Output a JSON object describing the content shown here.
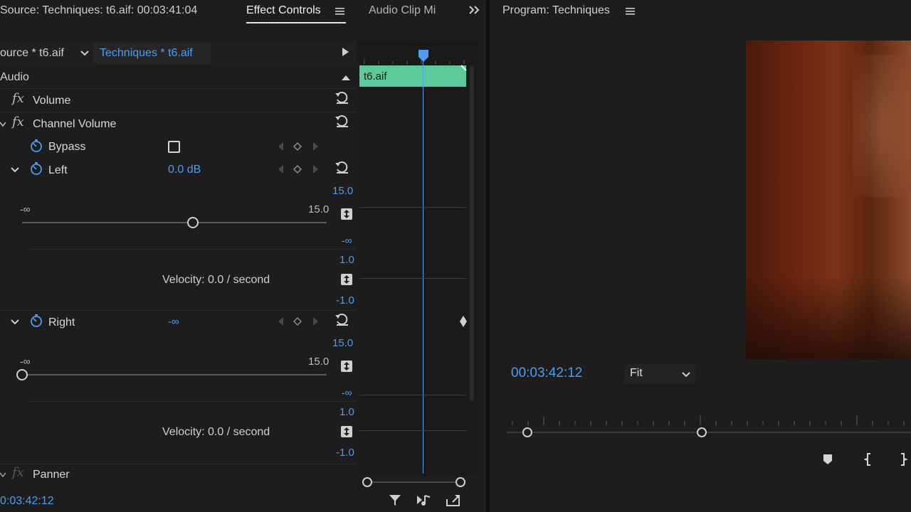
{
  "tabs": {
    "source": "Source: Techniques: t6.aif: 00:03:41:04",
    "effect_controls": "Effect Controls",
    "audio_clip_mixer": "Audio Clip Mi",
    "program": "Program: Techniques"
  },
  "breadcrumb": {
    "master": "ource * t6.aif",
    "sequence": "Techniques * t6.aif"
  },
  "section": {
    "title": "Audio"
  },
  "effects": {
    "volume": "Volume",
    "channel_volume": "Channel Volume",
    "panner": "Panner"
  },
  "bypass": {
    "label": "Bypass",
    "checked": false
  },
  "left": {
    "label": "Left",
    "value": "0.0 dB",
    "slider_min": "-∞",
    "slider_max": "15.0",
    "graph_max": "15.0",
    "graph_min": "-∞",
    "vel_max": "1.0",
    "vel_min": "-1.0",
    "velocity": "Velocity: 0.0 / second"
  },
  "right": {
    "label": "Right",
    "value": "-∞",
    "slider_min": "-∞",
    "slider_max": "15.0",
    "graph_max": "15.0",
    "graph_min": "-∞",
    "vel_max": "1.0",
    "vel_min": "-1.0",
    "velocity": "Velocity: 0.0 / second"
  },
  "timeline": {
    "clip_name": "t6.aif"
  },
  "footer": {
    "timecode": "0:03:42:12"
  },
  "program": {
    "timecode": "00:03:42:12",
    "zoom": "Fit"
  },
  "colors": {
    "accent": "#4f9cf0",
    "clip": "#5cc99a",
    "panel_bg": "#1d1d1d",
    "divider": "#0f0f0f"
  }
}
